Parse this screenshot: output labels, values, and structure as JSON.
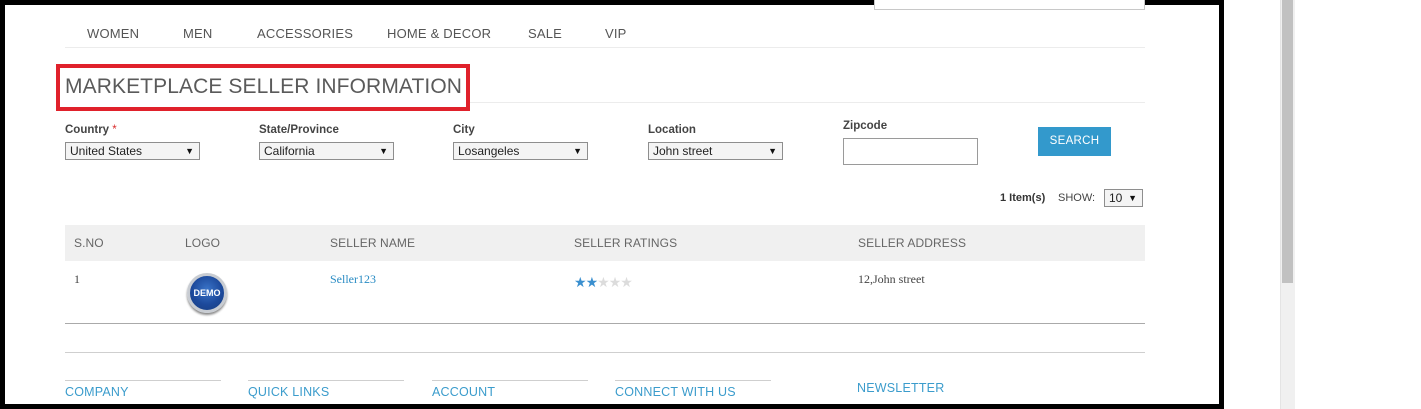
{
  "nav": {
    "items": [
      "WOMEN",
      "MEN",
      "ACCESSORIES",
      "HOME & DECOR",
      "SALE",
      "VIP"
    ]
  },
  "page_title": "MARKETPLACE SELLER INFORMATION",
  "filters": {
    "country": {
      "label": "Country",
      "required_mark": "*",
      "value": "United States"
    },
    "state": {
      "label": "State/Province",
      "value": "California"
    },
    "city": {
      "label": "City",
      "value": "Losangeles"
    },
    "location": {
      "label": "Location",
      "value": "John street"
    },
    "zipcode": {
      "label": "Zipcode",
      "value": ""
    },
    "search_label": "SEARCH"
  },
  "pager": {
    "items_count": "1 Item(s)",
    "show_label": "SHOW:",
    "show_value": "10"
  },
  "table": {
    "headers": [
      "S.NO",
      "LOGO",
      "SELLER NAME",
      "SELLER RATINGS",
      "SELLER ADDRESS"
    ],
    "rows": [
      {
        "sno": "1",
        "logo_text": "DEMO",
        "seller_name": "Seller123",
        "rating": 2,
        "rating_max": 5,
        "address": "12,John street"
      }
    ]
  },
  "footer": {
    "columns": [
      "COMPANY",
      "QUICK LINKS",
      "ACCOUNT",
      "CONNECT WITH US"
    ],
    "newsletter": "NEWSLETTER"
  },
  "colors": {
    "accent": "#3399cc",
    "highlight_box": "#e0212b",
    "star_on": "#3a8fcf",
    "star_off": "#dcdcdc"
  },
  "icons": {
    "dropdown": "chevron-down-icon",
    "rating": "star-icon"
  }
}
